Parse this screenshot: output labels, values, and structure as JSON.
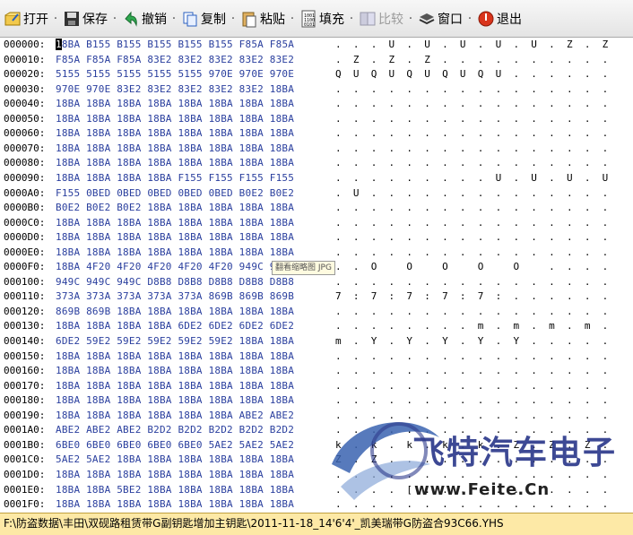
{
  "toolbar": {
    "buttons": [
      {
        "label": "打开",
        "icon": "open-folder-icon"
      },
      {
        "label": "保存",
        "icon": "save-disk-icon"
      },
      {
        "label": "撤销",
        "icon": "undo-icon"
      },
      {
        "label": "复制",
        "icon": "copy-icon"
      },
      {
        "label": "粘贴",
        "icon": "paste-icon"
      },
      {
        "label": "填充",
        "icon": "fill-binary-icon"
      },
      {
        "label": "比较",
        "icon": "compare-icon",
        "disabled": true
      },
      {
        "label": "窗口",
        "icon": "window-layers-icon"
      },
      {
        "label": "退出",
        "icon": "exit-icon"
      }
    ],
    "separator": "·"
  },
  "hex_rows": [
    {
      "addr": "000000:",
      "hex": "18BA B155 B155 B155 B155 B155 F85A F85A",
      "ascii": ". . . U . U . U . U . U . Z . Z"
    },
    {
      "addr": "000010:",
      "hex": "F85A F85A F85A 83E2 83E2 83E2 83E2 83E2",
      "ascii": ". Z . Z . Z . . . . . . . . . ."
    },
    {
      "addr": "000020:",
      "hex": "5155 5155 5155 5155 5155 970E 970E 970E",
      "ascii": "Q U Q U Q U Q U Q U . . . . . ."
    },
    {
      "addr": "000030:",
      "hex": "970E 970E 83E2 83E2 83E2 83E2 83E2 18BA",
      "ascii": ". . . . . . . . . . . . . . . ."
    },
    {
      "addr": "000040:",
      "hex": "18BA 18BA 18BA 18BA 18BA 18BA 18BA 18BA",
      "ascii": ". . . . . . . . . . . . . . . ."
    },
    {
      "addr": "000050:",
      "hex": "18BA 18BA 18BA 18BA 18BA 18BA 18BA 18BA",
      "ascii": ". . . . . . . . . . . . . . . ."
    },
    {
      "addr": "000060:",
      "hex": "18BA 18BA 18BA 18BA 18BA 18BA 18BA 18BA",
      "ascii": ". . . . . . . . . . . . . . . ."
    },
    {
      "addr": "000070:",
      "hex": "18BA 18BA 18BA 18BA 18BA 18BA 18BA 18BA",
      "ascii": ". . . . . . . . . . . . . . . ."
    },
    {
      "addr": "000080:",
      "hex": "18BA 18BA 18BA 18BA 18BA 18BA 18BA 18BA",
      "ascii": ". . . . . . . . . . . . . . . ."
    },
    {
      "addr": "000090:",
      "hex": "18BA 18BA 18BA 18BA F155 F155 F155 F155",
      "ascii": ". . . . . . . . . U . U . U . U"
    },
    {
      "addr": "0000A0:",
      "hex": "F155 0BED 0BED 0BED 0BED 0BED B0E2 B0E2",
      "ascii": ". U . . . . . . . . . . . . . ."
    },
    {
      "addr": "0000B0:",
      "hex": "B0E2 B0E2 B0E2 18BA 18BA 18BA 18BA 18BA",
      "ascii": ". . . . . . . . . . . . . . . ."
    },
    {
      "addr": "0000C0:",
      "hex": "18BA 18BA 18BA 18BA 18BA 18BA 18BA 18BA",
      "ascii": ". . . . . . . . . . . . . . . ."
    },
    {
      "addr": "0000D0:",
      "hex": "18BA 18BA 18BA 18BA 18BA 18BA 18BA 18BA",
      "ascii": ". . . . . . . . . . . . . . . ."
    },
    {
      "addr": "0000E0:",
      "hex": "18BA 18BA 18BA 18BA 18BA 18BA 18BA 18BA",
      "ascii": ". . . . . . . . . . . . . . . ."
    },
    {
      "addr": "0000F0:",
      "hex": "18BA 4F20 4F20 4F20 4F20 4F20 949C 949C",
      "ascii": ". . O   O   O   O   O   . . . ."
    },
    {
      "addr": "000100:",
      "hex": "949C 949C 949C D8B8 D8B8 D8B8 D8B8 D8B8",
      "ascii": ". . . . . . . . . . . . . . . ."
    },
    {
      "addr": "000110:",
      "hex": "373A 373A 373A 373A 373A 869B 869B 869B",
      "ascii": "7 : 7 : 7 : 7 : 7 : . . . . . ."
    },
    {
      "addr": "000120:",
      "hex": "869B 869B 18BA 18BA 18BA 18BA 18BA 18BA",
      "ascii": ". . . . . . . . . . . . . . . ."
    },
    {
      "addr": "000130:",
      "hex": "18BA 18BA 18BA 18BA 6DE2 6DE2 6DE2 6DE2",
      "ascii": ". . . . . . . . m . m . m . m ."
    },
    {
      "addr": "000140:",
      "hex": "6DE2 59E2 59E2 59E2 59E2 59E2 18BA 18BA",
      "ascii": "m . Y . Y . Y . Y . Y . . . . ."
    },
    {
      "addr": "000150:",
      "hex": "18BA 18BA 18BA 18BA 18BA 18BA 18BA 18BA",
      "ascii": ". . . . . . . . . . . . . . . ."
    },
    {
      "addr": "000160:",
      "hex": "18BA 18BA 18BA 18BA 18BA 18BA 18BA 18BA",
      "ascii": ". . . . . . . . . . . . . . . ."
    },
    {
      "addr": "000170:",
      "hex": "18BA 18BA 18BA 18BA 18BA 18BA 18BA 18BA",
      "ascii": ". . . . . . . . . . . . . . . ."
    },
    {
      "addr": "000180:",
      "hex": "18BA 18BA 18BA 18BA 18BA 18BA 18BA 18BA",
      "ascii": ". . . . . . . . . . . . . . . ."
    },
    {
      "addr": "000190:",
      "hex": "18BA 18BA 18BA 18BA 18BA 18BA ABE2 ABE2",
      "ascii": ". . . . . . . . . . . . . . . ."
    },
    {
      "addr": "0001A0:",
      "hex": "ABE2 ABE2 ABE2 B2D2 B2D2 B2D2 B2D2 B2D2",
      "ascii": ". . . . . . . . . . . . . . . ."
    },
    {
      "addr": "0001B0:",
      "hex": "6BE0 6BE0 6BE0 6BE0 6BE0 5AE2 5AE2 5AE2",
      "ascii": "k . k . k . k . k . Z . Z . Z ."
    },
    {
      "addr": "0001C0:",
      "hex": "5AE2 5AE2 18BA 18BA 18BA 18BA 18BA 18BA",
      "ascii": "Z . Z . . . . . . . . . . . . ."
    },
    {
      "addr": "0001D0:",
      "hex": "18BA 18BA 18BA 18BA 18BA 18BA 18BA 18BA",
      "ascii": ". . . . . . . . . . . . . . . ."
    },
    {
      "addr": "0001E0:",
      "hex": "18BA 18BA 5BE2 18BA 18BA 18BA 18BA 18BA",
      "ascii": ". . . . [ . . . . . . . . . . ."
    },
    {
      "addr": "0001F0:",
      "hex": "18BA 18BA 18BA 18BA 18BA 18BA 18BA 18BA",
      "ascii": ". . . . . . . . . . . . . . . ."
    }
  ],
  "tooltip": "翻看缩略图 JPG",
  "status_path": "F:\\防盗数据\\丰田\\双砚路租赁带G副钥匙增加主钥匙\\2011-11-18_14'6'4'_凯美瑞带G防盗合93C66.YHS",
  "watermark": {
    "title": "飞特汽车电子",
    "url": "www.Feite.Cn"
  },
  "colors": {
    "hex_text": "#2a3f9e",
    "status_bg": "#fde9a6",
    "toolbar_bg": "#e9e9e9"
  }
}
